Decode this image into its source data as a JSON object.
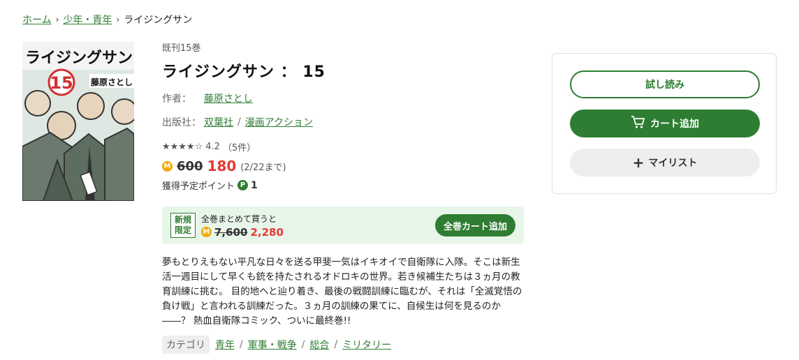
{
  "breadcrumb": {
    "home": "ホーム",
    "category": "少年・青年",
    "current": "ライジングサン"
  },
  "cover": {
    "title_art": "ライジングサン",
    "volume_art": "15",
    "author_art": "藤原さとし"
  },
  "book": {
    "series_count": "既刊15巻",
    "title": "ライジングサン ： 15",
    "author_label": "作者：",
    "author": "藤原さとし",
    "publisher_label": "出版社：",
    "publisher": "双葉社",
    "label": "漫画アクション",
    "stars": "★★★★☆",
    "rating": "4.2",
    "review_count": "（5件）",
    "coin_icon": "M",
    "old_price": "600",
    "new_price": "180",
    "price_until": "(2/22まで)",
    "points_label": "獲得予定ポイント",
    "points_icon": "P",
    "points_value": "1"
  },
  "bundle": {
    "badge_line1": "新規",
    "badge_line2": "限定",
    "label": "全巻まとめて買うと",
    "old_price": "7,600",
    "new_price": "2,280",
    "button": "全巻カート追加"
  },
  "description": "夢もとりえもない平凡な日々を送る甲斐一気はイキオイで自衛隊に入隊。そこは新生活一週目にして早くも銃を持たされるオドロキの世界。若き候補生たちは３ヵ月の教育訓練に挑む。 目的地へと辿り着き、最後の戦闘訓練に臨むが、それは「全滅覚悟の負け戦」と言われる訓練だった。３ヵ月の訓練の果てに、自候生は何を見るのか――？ 熱血自衛隊コミック、ついに最終巻!!",
  "category": {
    "label": "カテゴリ",
    "items": [
      "青年",
      "軍事・戦争",
      "総合",
      "ミリタリー"
    ]
  },
  "actions": {
    "sample": "試し読み",
    "cart": "カート追加",
    "mylist": "マイリスト"
  },
  "colors": {
    "accent": "#2e7d32",
    "price": "#e53935",
    "coin": "#f2a900",
    "bundle_bg": "#e8f5e9"
  }
}
